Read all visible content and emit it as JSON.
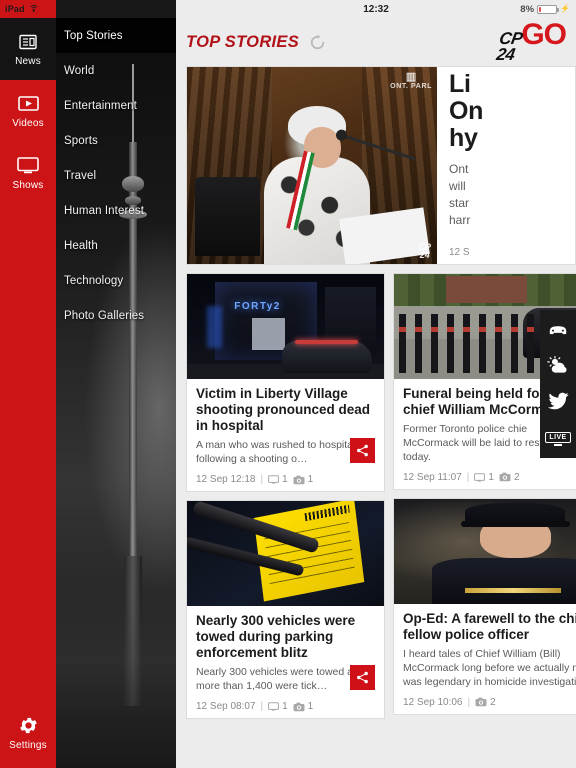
{
  "statusbar": {
    "device": "iPad",
    "wifi_icon": "wifi-icon",
    "time": "12:32",
    "battery_percent": "8%",
    "charging_icon": "lightning-bolt-icon"
  },
  "rail": {
    "items": [
      {
        "label": "News",
        "icon": "newspaper-icon",
        "active": true
      },
      {
        "label": "Videos",
        "icon": "video-play-icon",
        "active": false
      },
      {
        "label": "Shows",
        "icon": "tv-monitor-icon",
        "active": false
      }
    ],
    "settings": {
      "label": "Settings",
      "icon": "gear-icon"
    }
  },
  "nav": {
    "items": [
      {
        "label": "Top Stories",
        "active": true
      },
      {
        "label": "World",
        "active": false
      },
      {
        "label": "Entertainment",
        "active": false
      },
      {
        "label": "Sports",
        "active": false
      },
      {
        "label": "Travel",
        "active": false
      },
      {
        "label": "Human Interest",
        "active": false
      },
      {
        "label": "Health",
        "active": false
      },
      {
        "label": "Technology",
        "active": false
      },
      {
        "label": "Photo Galleries",
        "active": false
      }
    ]
  },
  "header": {
    "title": "TOP STORIES",
    "refresh_icon": "refresh-icon",
    "logo_cp": "CP",
    "logo_24": "24",
    "logo_go": "GO"
  },
  "featured": {
    "headline": "Li\nOn\nhy",
    "summary": "Ont\nwill\nstar\nharr",
    "timestamp": "12 S",
    "image": {
      "name": "ontario-legislature-photo",
      "watermark_building": "ONT. PARL",
      "watermark_logo_cp": "CP",
      "watermark_logo_24": "24"
    }
  },
  "cards": [
    {
      "image_name": "liberty-village-night-police-photo",
      "image_sign": "FORTy2",
      "headline": "Victim in Liberty Village shooting pronounced dead in hospital",
      "summary": "A man who was rushed to hospital following a shooting o…",
      "timestamp": "12 Sep 12:18",
      "comments": "1",
      "photos": "1",
      "share_icon": "share-icon",
      "has_share": true
    },
    {
      "image_name": "police-funeral-procession-photo",
      "image_sign": "",
      "headline": "Funeral being held for fo\nchief William McCormac",
      "summary": "Former Toronto police chie\nMcCormack will be laid to rest\ntoday.",
      "timestamp": "12 Sep 11:07",
      "comments": "1",
      "photos": "2",
      "share_icon": "share-icon",
      "has_share": false
    },
    {
      "image_name": "parking-ticket-windshield-photo",
      "image_sign": "",
      "headline": "Nearly 300 vehicles were towed during parking enforcement blitz",
      "summary": "Nearly 300 vehicles were towed and more than 1,400 were tick…",
      "timestamp": "12 Sep 08:07",
      "comments": "1",
      "photos": "1",
      "share_icon": "share-icon",
      "has_share": true
    },
    {
      "image_name": "police-chief-portrait-photo",
      "image_sign": "",
      "headline": "Op-Ed: A farewell to the chief f\nfellow police officer",
      "summary": "I heard tales of Chief William (Bill)\nMcCormack long before we actually met. H\nwas legendary in homicide investigation ci",
      "timestamp": "12 Sep 10:06",
      "comments": "",
      "photos": "2",
      "share_icon": "share-icon",
      "has_share": false
    }
  ],
  "righttools": {
    "items": [
      {
        "name": "traffic-car-icon",
        "label": ""
      },
      {
        "name": "weather-icon",
        "label": ""
      },
      {
        "name": "twitter-icon",
        "label": ""
      },
      {
        "name": "live-tv-icon",
        "label": "LIVE"
      }
    ]
  },
  "colors": {
    "brand_red": "#cc1417",
    "logo_red": "#d6171d",
    "title_red": "#b01217",
    "share_red": "#cf1016",
    "dark": "#141414",
    "page_bg": "#ececec"
  }
}
